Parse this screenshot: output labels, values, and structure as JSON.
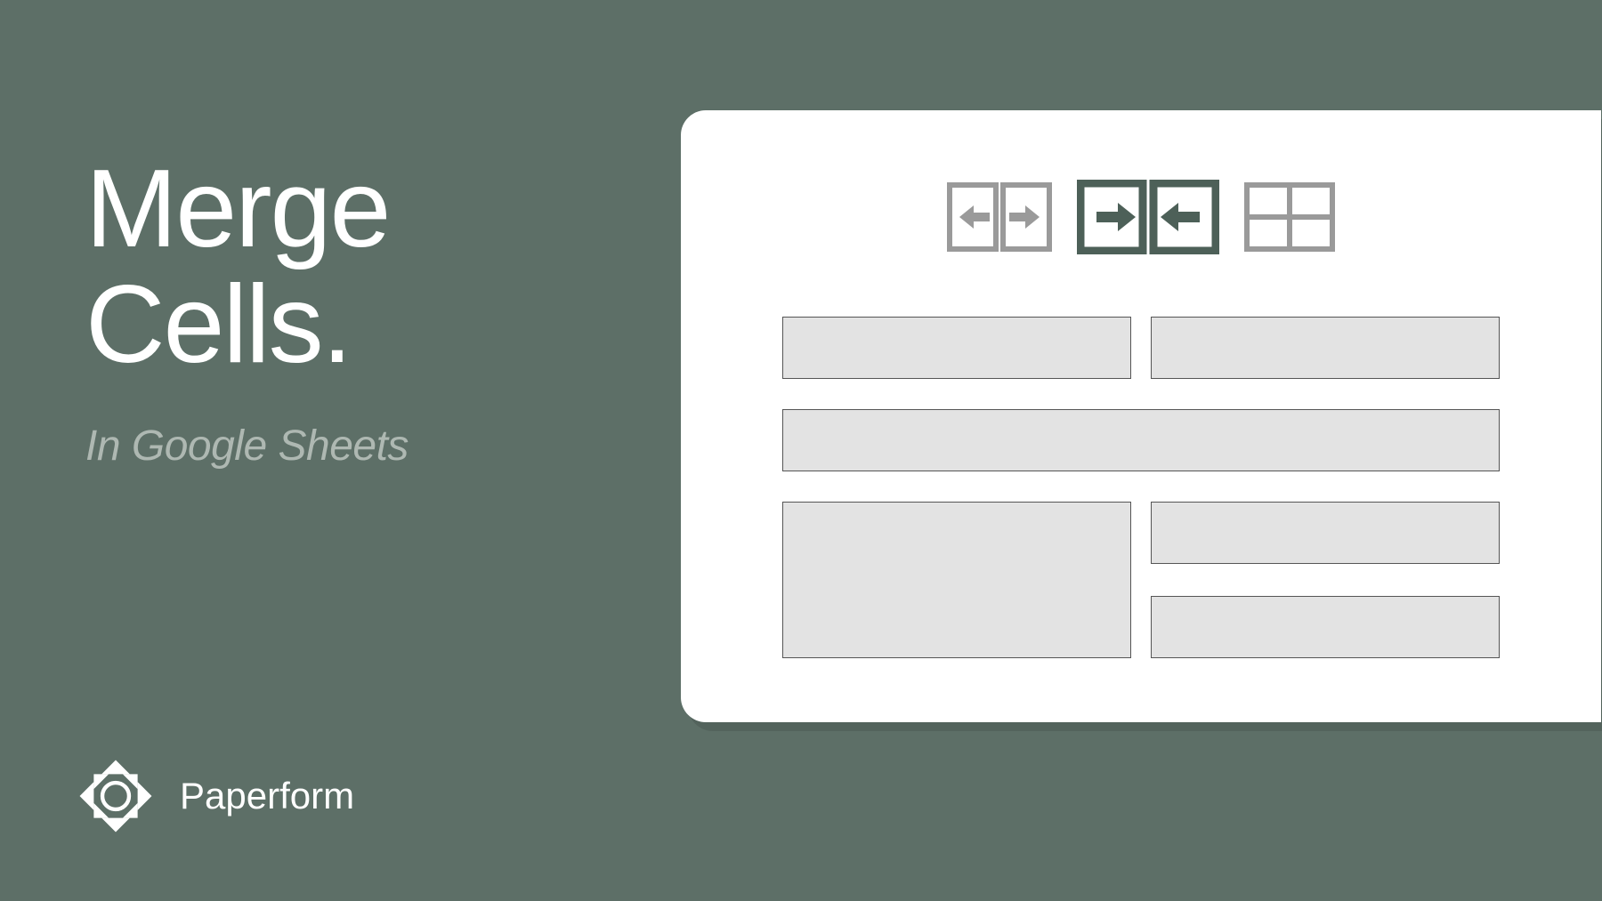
{
  "heading": {
    "line1": "Merge",
    "line2": "Cells."
  },
  "subtitle": "In Google Sheets",
  "brand": {
    "name": "Paperform"
  },
  "icons": {
    "unmerge": "unmerge-cells-icon",
    "merge_horizontal": "merge-horizontal-icon",
    "borders": "borders-grid-icon"
  },
  "colors": {
    "background": "#5d6f67",
    "card": "#ffffff",
    "cell_fill": "#e3e3e3",
    "icon_inactive": "#9a9a9a",
    "icon_active": "#4d6058"
  }
}
